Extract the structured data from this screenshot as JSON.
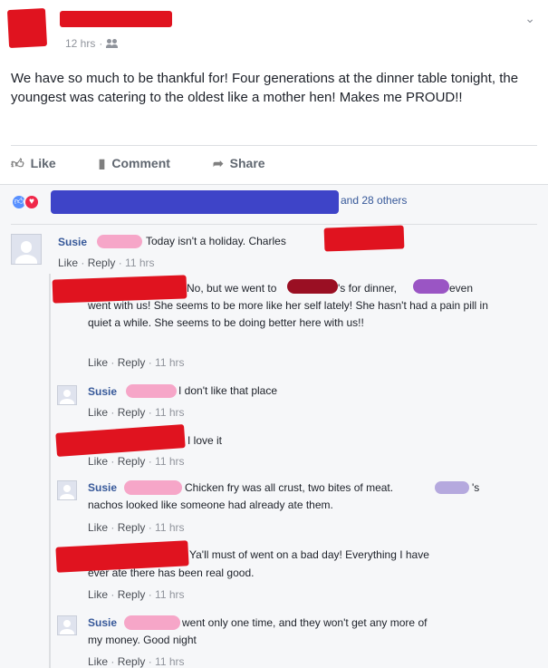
{
  "post": {
    "timestamp": "12 hrs",
    "separator": "·",
    "text": "We have so much to be thankful for! Four generations at the dinner table tonight, the youngest was catering to the oldest like a mother hen! Makes me PROUD!!",
    "privacy_icon": "people-icon",
    "menu_icon": "chevron-down-icon"
  },
  "actions": {
    "like": "Like",
    "comment": "Comment",
    "share": "Share"
  },
  "reactions": {
    "summary_suffix": "and 28 others"
  },
  "comments": [
    {
      "author": "Susie",
      "text": "Today isn't a holiday. Charles",
      "like": "Like",
      "reply": "Reply",
      "time": "11 hrs"
    },
    {
      "author": "",
      "text_a": "No, but we went to",
      "text_b": "'s for dinner,",
      "text_c": "even",
      "text_rest": "went with us! She seems to be more like her self lately! She hasn't had a pain pill in quiet a while. She seems to be doing better here with us!!",
      "like": "Like",
      "reply": "Reply",
      "time": "11 hrs"
    },
    {
      "author": "Susie",
      "text": "I don't like that place",
      "like": "Like",
      "reply": "Reply",
      "time": "11 hrs"
    },
    {
      "author": "",
      "text": "I love it",
      "like": "Like",
      "reply": "Reply",
      "time": "11 hrs"
    },
    {
      "author": "Susie",
      "text_a": "Chicken fry was all crust, two bites of meat.",
      "text_b": "'s",
      "text_rest": "nachos looked like someone had already ate them.",
      "like": "Like",
      "reply": "Reply",
      "time": "11 hrs"
    },
    {
      "author": "",
      "text_a": "Ya'll must of went on a bad day! Everything I have",
      "text_rest": "ever ate there has been real good.",
      "like": "Like",
      "reply": "Reply",
      "time": "11 hrs"
    },
    {
      "author": "Susie",
      "text_a": "went only one time, and they won't get any more of",
      "text_rest": "my money. Good night",
      "like": "Like",
      "reply": "Reply",
      "time": "11 hrs"
    }
  ],
  "colors": {
    "link": "#365899",
    "meta": "#90949c",
    "redaction_red": "#e0131f",
    "redaction_blue": "#3e44c8",
    "redaction_pink": "#f6a6c8"
  }
}
